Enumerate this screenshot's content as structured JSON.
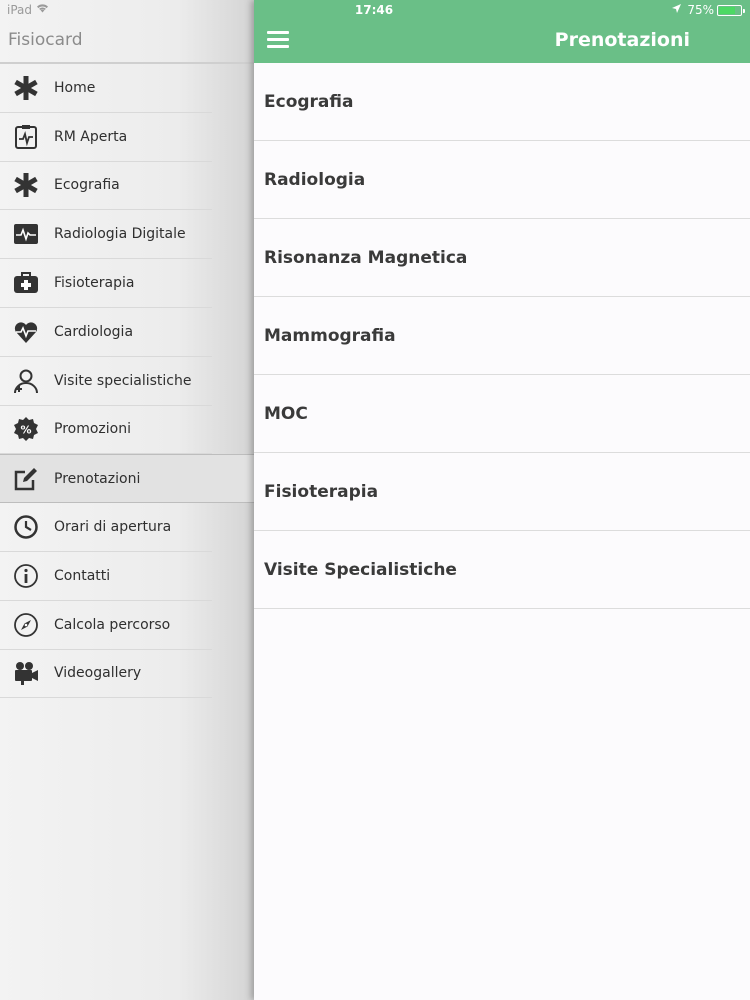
{
  "status_bar": {
    "carrier": "iPad",
    "time": "17:46",
    "battery": "75%",
    "battery_level": 0.75
  },
  "sidebar": {
    "title": "Fisiocard",
    "items": [
      {
        "label": "Home",
        "icon": "asterisk-icon"
      },
      {
        "label": "RM Aperta",
        "icon": "clipboard-pulse-icon"
      },
      {
        "label": "Ecografia",
        "icon": "asterisk-icon"
      },
      {
        "label": "Radiologia Digitale",
        "icon": "monitor-pulse-icon"
      },
      {
        "label": "Fisioterapia",
        "icon": "medical-kit-icon"
      },
      {
        "label": "Cardiologia",
        "icon": "heart-pulse-icon"
      },
      {
        "label": "Visite specialistiche",
        "icon": "doctor-icon"
      },
      {
        "label": "Promozioni",
        "icon": "percent-badge-icon"
      },
      {
        "label": "Prenotazioni",
        "icon": "edit-icon",
        "active": true
      },
      {
        "label": "Orari di apertura",
        "icon": "clock-icon"
      },
      {
        "label": "Contatti",
        "icon": "info-icon"
      },
      {
        "label": "Calcola percorso",
        "icon": "compass-icon"
      },
      {
        "label": "Videogallery",
        "icon": "video-camera-icon"
      }
    ]
  },
  "header": {
    "title": "Prenotazioni",
    "accent_color": "#6abf87"
  },
  "main": {
    "items": [
      {
        "label": "Ecografia"
      },
      {
        "label": "Radiologia"
      },
      {
        "label": "Risonanza Magnetica"
      },
      {
        "label": "Mammografia"
      },
      {
        "label": "MOC"
      },
      {
        "label": "Fisioterapia"
      },
      {
        "label": "Visite Specialistiche"
      }
    ]
  }
}
